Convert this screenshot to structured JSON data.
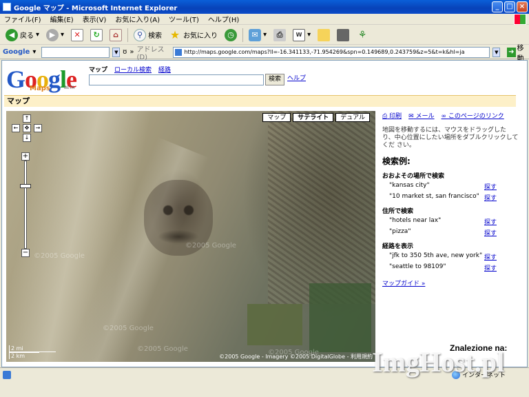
{
  "window": {
    "title": "Google マップ - Microsoft Internet Explorer"
  },
  "menubar": {
    "items": [
      "ファイル(F)",
      "編集(E)",
      "表示(V)",
      "お気に入り(A)",
      "ツール(T)",
      "ヘルプ(H)"
    ]
  },
  "toolbar": {
    "back": "戻る",
    "search": "検索",
    "favorites": "お気に入り"
  },
  "addressbar": {
    "google_label": "Google",
    "address_label": "アドレス(D)",
    "url": "http://maps.google.com/maps?ll=-16.341133,-71.954269&spn=0.149689,0.243759&z=5&t=k&hl=ja",
    "go_label": "移動"
  },
  "gmaps": {
    "logo_sub": "Maps",
    "beta": "BETA",
    "tabs": {
      "maps": "マップ",
      "local": "ローカル検索",
      "directions": "経路"
    },
    "search_button": "検索",
    "help_link": "ヘルプ",
    "section_title": "マップ"
  },
  "map": {
    "tabs": [
      "マップ",
      "サテライト",
      "デュアル"
    ],
    "active_tab": "サテライト",
    "scale_mi": "2 mi",
    "scale_km": "2 km",
    "copyright": "©2005 Google - Imagery ©2005 DigitalGlobe - 利用規約",
    "watermark": "©2005 Google"
  },
  "sidebar": {
    "print": "印刷",
    "mail": "メール",
    "link": "このページのリンク",
    "instructions": "地図を移動するには、マウスをドラッグした り、中心位置にしたい場所をダブルクリックしてくだ さい。",
    "examples_title": "検索例:",
    "groups": [
      {
        "title": "おおよその場所で検索",
        "items": [
          {
            "q": "\"kansas city\"",
            "go": "探す"
          },
          {
            "q": "\"10 market st, san francisco\"",
            "go": "探す"
          }
        ]
      },
      {
        "title": "住所で検索",
        "items": [
          {
            "q": "\"hotels near lax\"",
            "go": "探す"
          },
          {
            "q": "\"pizza\"",
            "go": "探す"
          }
        ]
      },
      {
        "title": "経路を表示",
        "items": [
          {
            "q": "\"jfk to 350 5th ave, new york\"",
            "go": "探す"
          },
          {
            "q": "\"seattle to 98109\"",
            "go": "探す"
          }
        ]
      }
    ],
    "guide": "マップガイド »"
  },
  "overlay": {
    "found_on": "Znalezione na:",
    "imghost": "ImgHost.pl"
  },
  "statusbar": {
    "zone": "インターネット"
  }
}
